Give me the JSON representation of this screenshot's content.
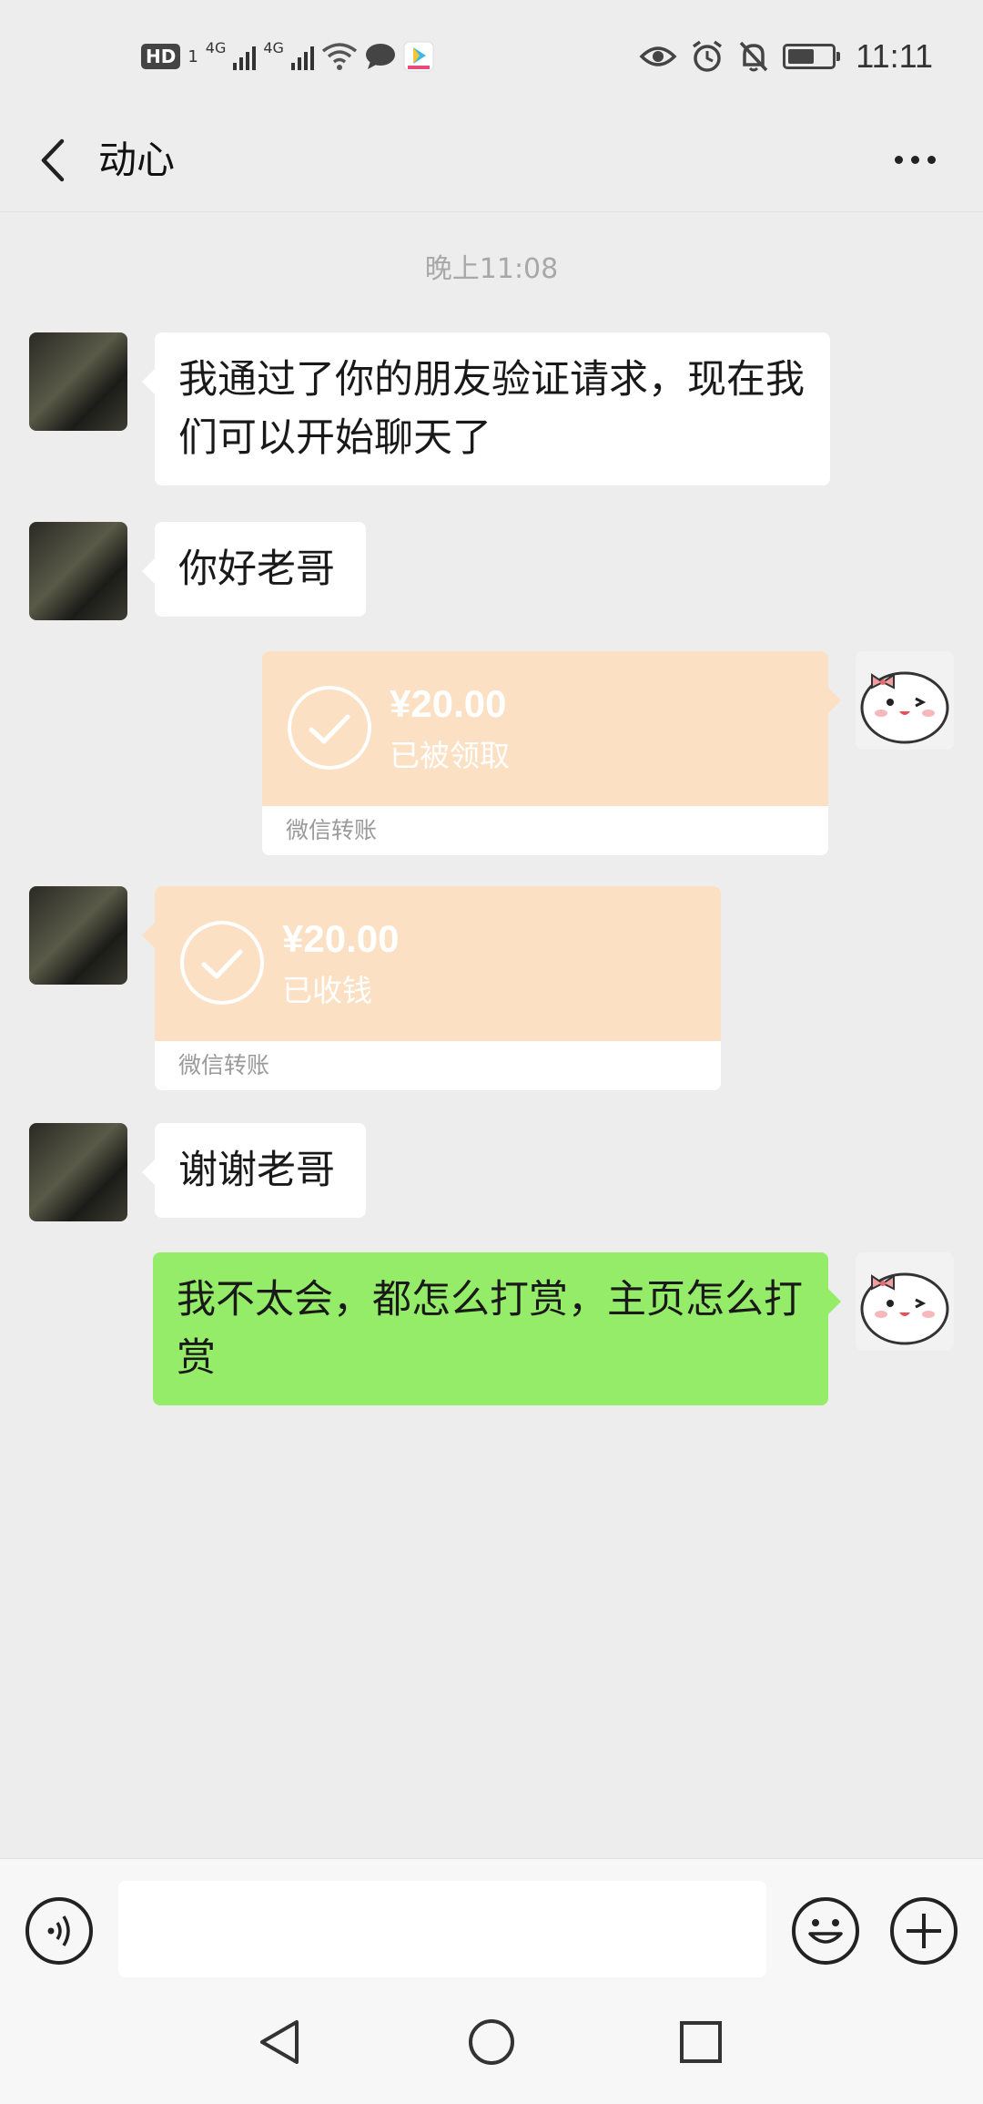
{
  "status_bar": {
    "hd_label": "HD",
    "sim_label": "1",
    "net1": "4G",
    "net2": "4G",
    "time": "11:11",
    "battery_level_percent": 60
  },
  "header": {
    "title": "动心",
    "back_icon": "chevron-left-icon",
    "more_icon": "more-dots-icon"
  },
  "chat": {
    "timestamp": "晚上11:08",
    "messages": [
      {
        "from": "other",
        "type": "text",
        "text": "我通过了你的朋友验证请求，现在我们可以开始聊天了"
      },
      {
        "from": "other",
        "type": "text",
        "text": "你好老哥"
      },
      {
        "from": "me",
        "type": "transfer",
        "amount": "¥20.00",
        "status": "已被领取",
        "footer": "微信转账"
      },
      {
        "from": "other",
        "type": "transfer",
        "amount": "¥20.00",
        "status": "已收钱",
        "footer": "微信转账"
      },
      {
        "from": "other",
        "type": "text",
        "text": "谢谢老哥"
      },
      {
        "from": "me",
        "type": "text",
        "text": "我不太会，都怎么打赏，主页怎么打赏"
      }
    ]
  },
  "input_bar": {
    "voice_icon": "voice-icon",
    "emoji_icon": "emoji-icon",
    "plus_icon": "plus-icon",
    "text_value": ""
  },
  "colors": {
    "background": "#ededed",
    "my_bubble": "#95ec69",
    "other_bubble": "#ffffff",
    "transfer": "#fce0c3"
  }
}
